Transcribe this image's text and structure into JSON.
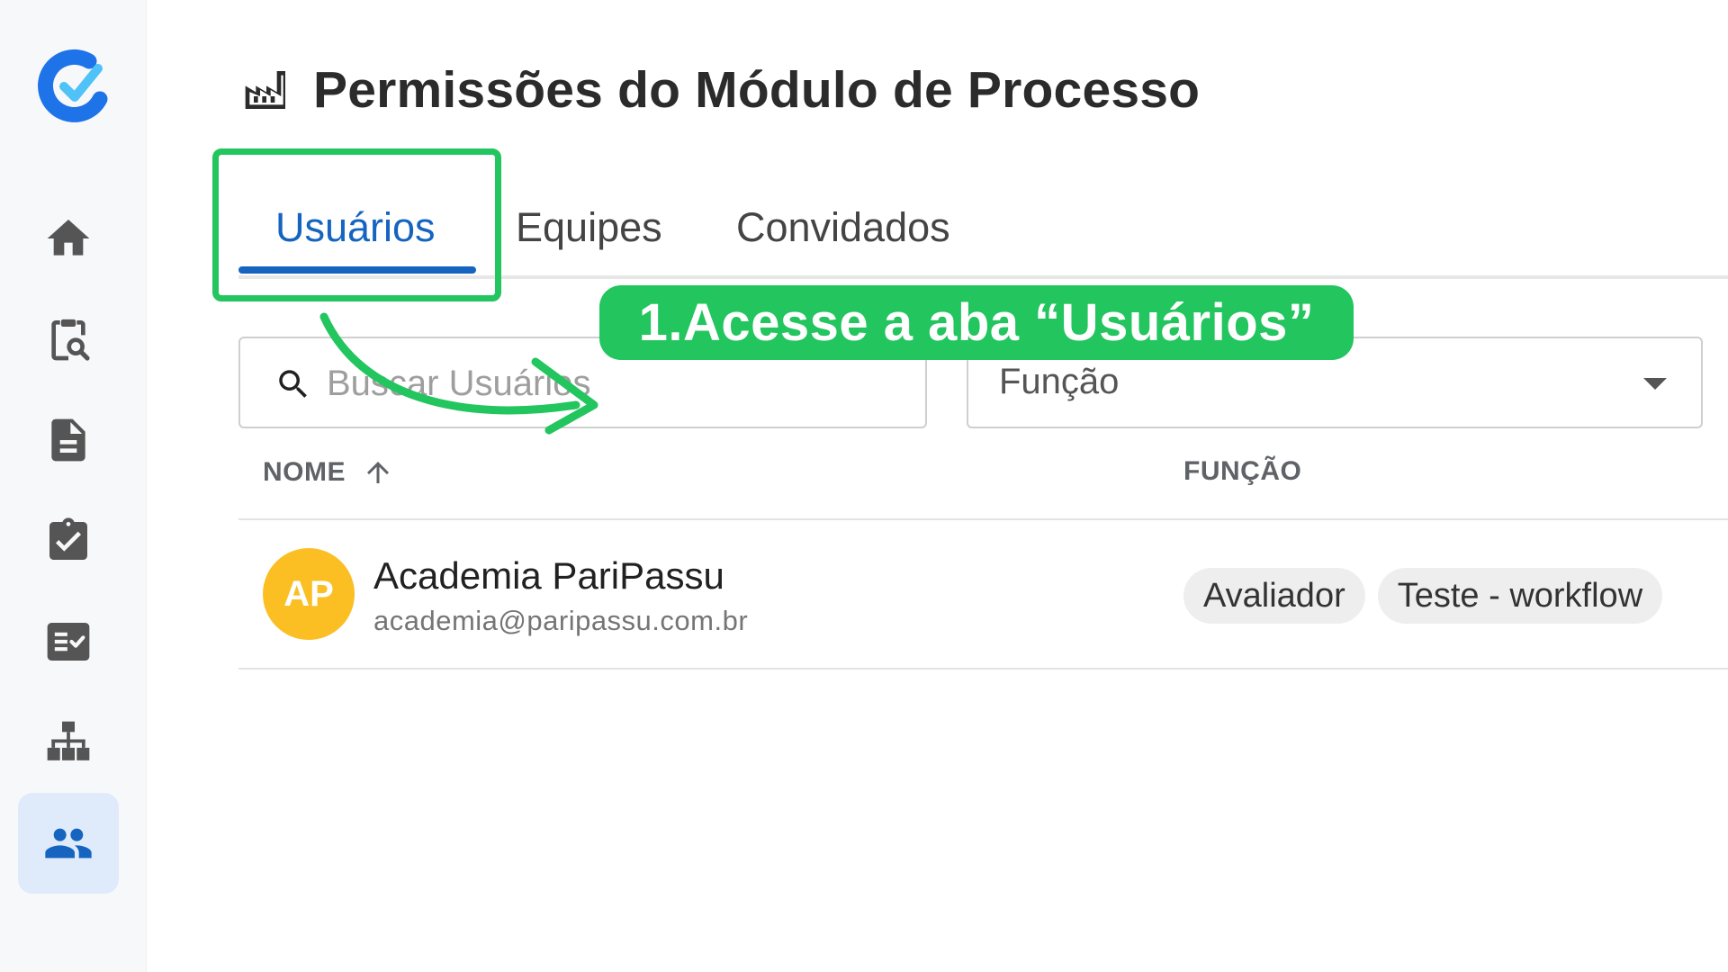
{
  "app": {
    "logo_icon": "check-c-logo",
    "accent": "#1565c0"
  },
  "sidebar": {
    "items": [
      {
        "name": "home",
        "icon": "home-icon",
        "active": false
      },
      {
        "name": "audit",
        "icon": "clipboard-search-icon",
        "active": false
      },
      {
        "name": "documents",
        "icon": "document-icon",
        "active": false
      },
      {
        "name": "tasks",
        "icon": "clipboard-check-icon",
        "active": false
      },
      {
        "name": "checklists",
        "icon": "checklist-icon",
        "active": false
      },
      {
        "name": "hierarchy",
        "icon": "sitemap-icon",
        "active": false
      },
      {
        "name": "users",
        "icon": "people-icon",
        "active": true
      }
    ]
  },
  "header": {
    "title": "Permissões do Módulo de Processo",
    "icon": "factory-icon"
  },
  "tabs": [
    {
      "label": "Usuários",
      "active": true
    },
    {
      "label": "Equipes",
      "active": false
    },
    {
      "label": "Convidados",
      "active": false
    }
  ],
  "filters": {
    "search_placeholder": "Buscar Usuários",
    "search_value": "",
    "role_label": "Função"
  },
  "table": {
    "columns": {
      "name": "NOME",
      "role": "FUNÇÃO"
    },
    "sort": {
      "column": "NOME",
      "direction": "asc"
    },
    "rows": [
      {
        "initials": "AP",
        "avatar_color": "#fbbf24",
        "name": "Academia PariPassu",
        "email": "academia@paripassu.com.br",
        "roles": [
          "Avaliador",
          "Teste - workflow"
        ]
      }
    ]
  },
  "annotation": {
    "text": "1.Acesse a aba “Usuários”",
    "color": "#22c55e"
  }
}
